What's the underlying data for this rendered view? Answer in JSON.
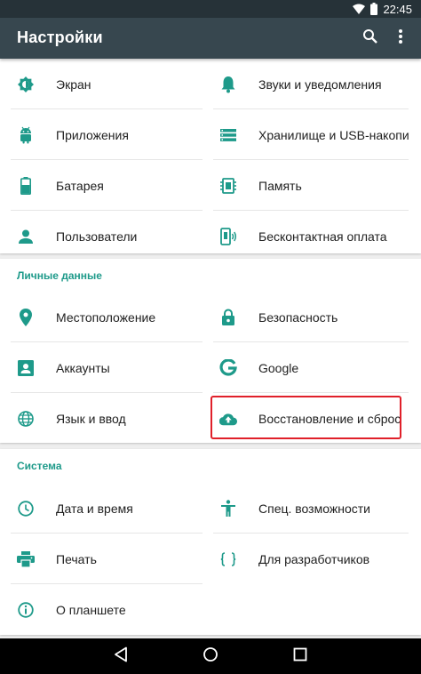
{
  "status_bar": {
    "time": "22:45"
  },
  "app_bar": {
    "title": "Настройки",
    "search_icon": "search-icon",
    "menu_icon": "more-vert-icon"
  },
  "colors": {
    "accent": "#1e9a8a",
    "app_bar": "#37474f",
    "status_bar": "#263238",
    "highlight": "#e0202a"
  },
  "device": {
    "items": [
      {
        "label": "Экран",
        "icon": "brightness-icon"
      },
      {
        "label": "Звуки и уведомления",
        "icon": "bell-icon"
      },
      {
        "label": "Приложения",
        "icon": "android-icon"
      },
      {
        "label": "Хранилище и USB-накопители",
        "icon": "storage-icon"
      },
      {
        "label": "Батарея",
        "icon": "battery-icon"
      },
      {
        "label": "Память",
        "icon": "memory-icon"
      },
      {
        "label": "Пользователи",
        "icon": "person-icon"
      },
      {
        "label": "Бесконтактная оплата",
        "icon": "tap-pay-icon"
      }
    ]
  },
  "personal": {
    "title": "Личные данные",
    "items": [
      {
        "label": "Местоположение",
        "icon": "location-icon"
      },
      {
        "label": "Безопасность",
        "icon": "lock-icon"
      },
      {
        "label": "Аккаунты",
        "icon": "account-icon"
      },
      {
        "label": "Google",
        "icon": "google-icon"
      },
      {
        "label": "Язык и ввод",
        "icon": "globe-icon"
      },
      {
        "label": "Восстановление и сброс",
        "icon": "cloud-upload-icon"
      }
    ]
  },
  "system": {
    "title": "Система",
    "items": [
      {
        "label": "Дата и время",
        "icon": "clock-icon"
      },
      {
        "label": "Спец. возможности",
        "icon": "accessibility-icon"
      },
      {
        "label": "Печать",
        "icon": "print-icon"
      },
      {
        "label": "Для разработчиков",
        "icon": "braces-icon"
      },
      {
        "label": "О планшете",
        "icon": "info-icon"
      }
    ]
  },
  "nav_bar": {
    "back_icon": "back-icon",
    "home_icon": "home-icon",
    "recents_icon": "recents-icon"
  }
}
